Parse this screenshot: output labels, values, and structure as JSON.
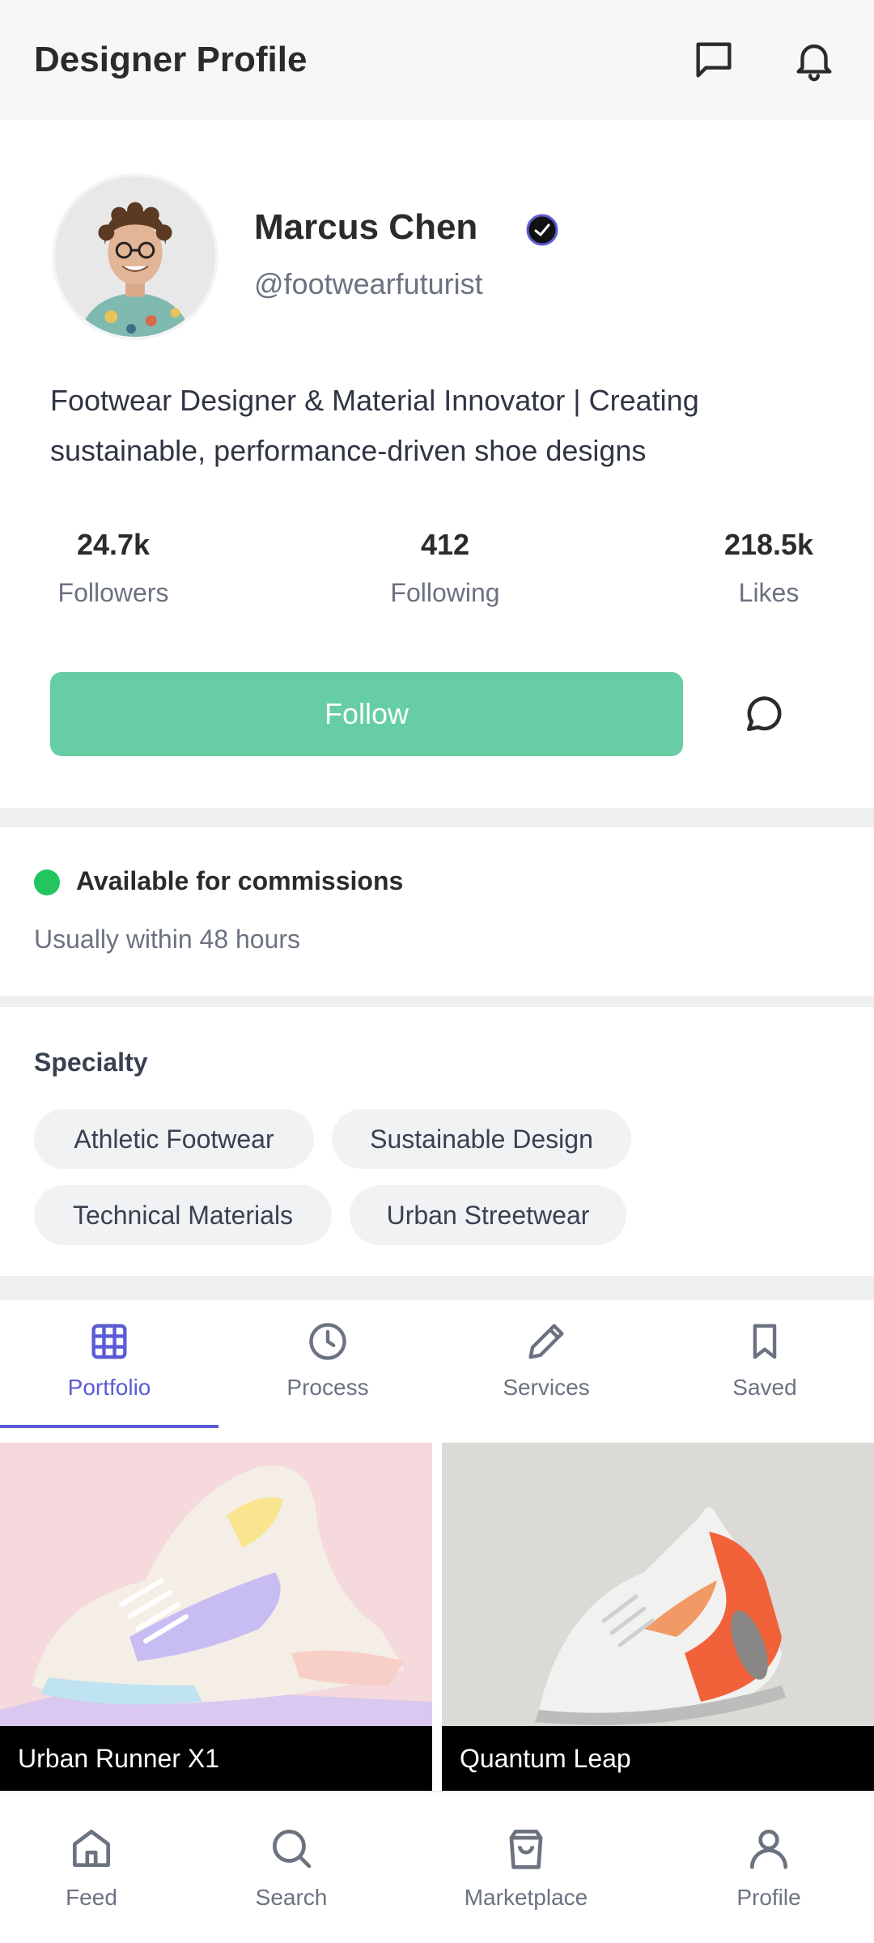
{
  "header": {
    "title": "Designer Profile",
    "icons": [
      "message-square-icon",
      "bell-icon"
    ]
  },
  "profile": {
    "name": "Marcus Chen",
    "handle": "@footwearfuturist",
    "verified": true,
    "bio": "Footwear Designer & Material Innovator | Creating sustainable, performance-driven shoe designs",
    "stats": [
      {
        "value": "24.7k",
        "label": "Followers"
      },
      {
        "value": "412",
        "label": "Following"
      },
      {
        "value": "218.5k",
        "label": "Likes"
      }
    ],
    "follow_label": "Follow"
  },
  "availability": {
    "status": "Available for commissions",
    "response": "Usually within 48 hours",
    "status_color": "#22c55e"
  },
  "specialty": {
    "title": "Specialty",
    "chips": [
      "Athletic Footwear",
      "Sustainable Design",
      "Technical Materials",
      "Urban Streetwear"
    ]
  },
  "tabs": [
    {
      "label": "Portfolio",
      "icon": "grid-icon",
      "active": true
    },
    {
      "label": "Process",
      "icon": "clock-icon",
      "active": false
    },
    {
      "label": "Services",
      "icon": "pencil-icon",
      "active": false
    },
    {
      "label": "Saved",
      "icon": "bookmark-icon",
      "active": false
    }
  ],
  "portfolio": [
    {
      "title": "Urban Runner X1"
    },
    {
      "title": "Quantum Leap"
    }
  ],
  "bottom_nav": [
    {
      "label": "Feed",
      "icon": "home-icon"
    },
    {
      "label": "Search",
      "icon": "search-icon"
    },
    {
      "label": "Marketplace",
      "icon": "shopping-bag-icon"
    },
    {
      "label": "Profile",
      "icon": "user-icon"
    }
  ],
  "colors": {
    "accent": "#5b5bd6",
    "follow": "#66cda5",
    "available": "#22c55e"
  }
}
